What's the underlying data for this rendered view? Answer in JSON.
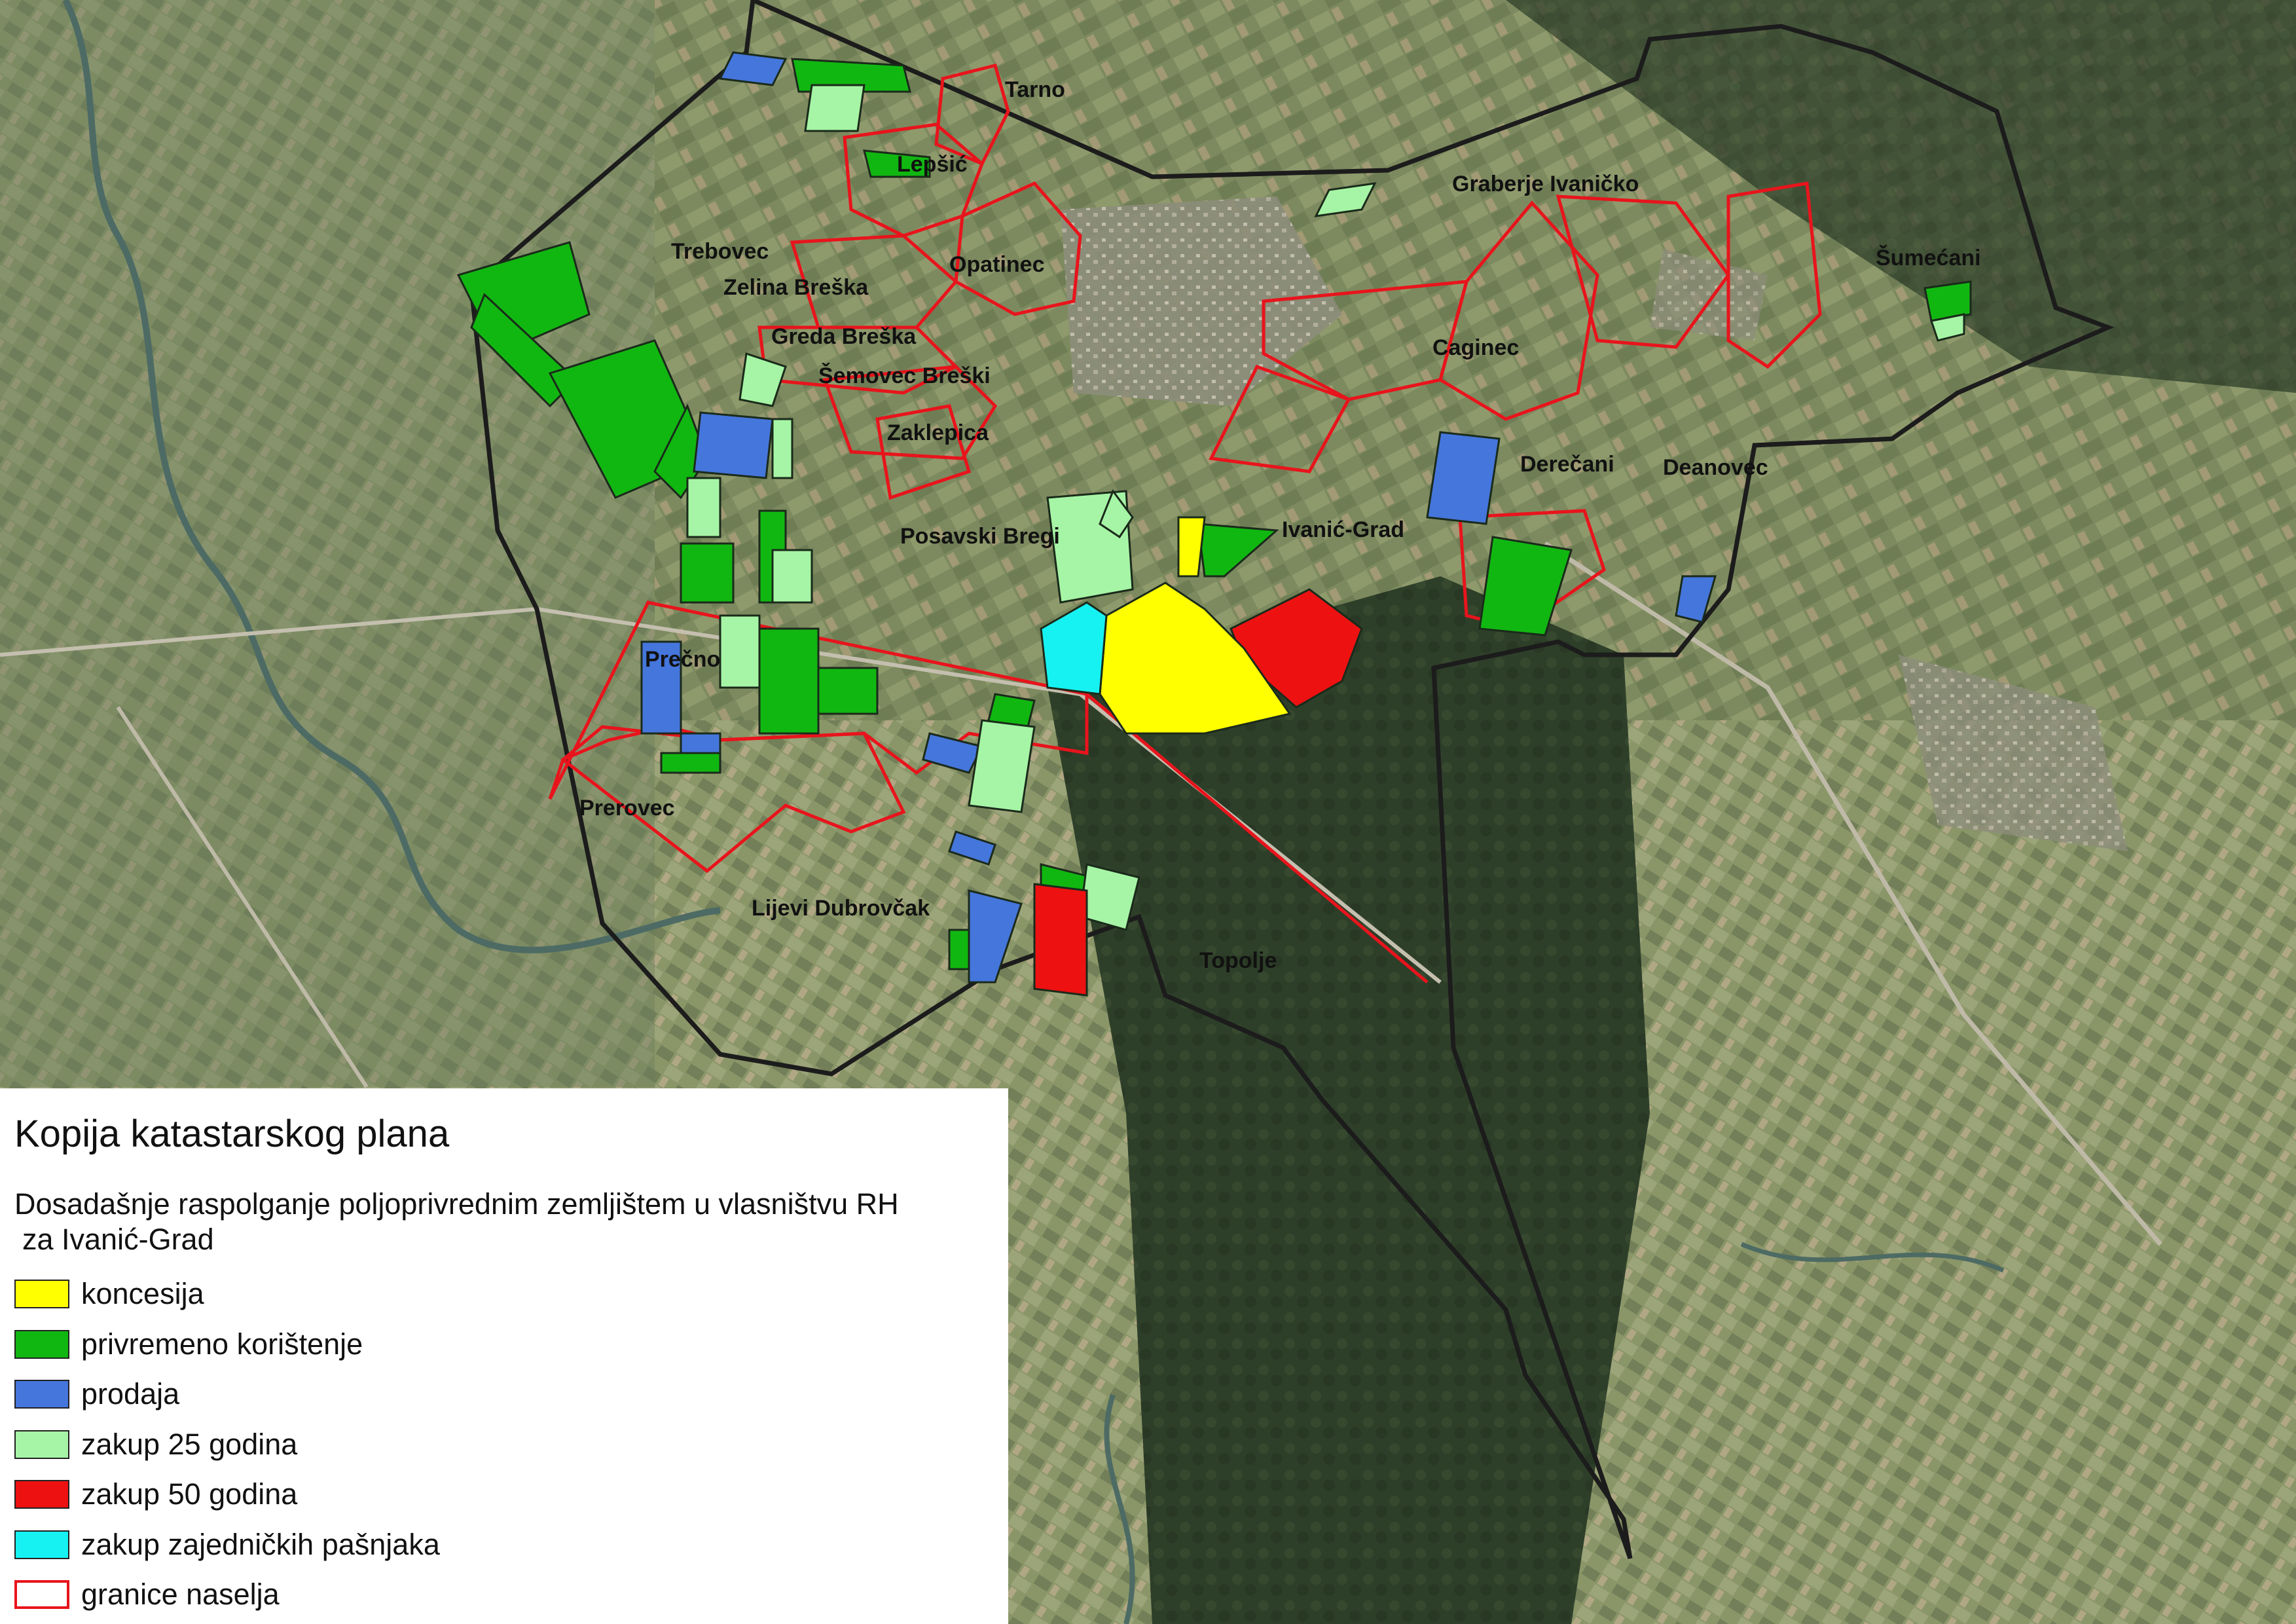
{
  "map": {
    "place_labels": [
      "Tarno",
      "Lepšić",
      "Trebovec",
      "Zelina Breška",
      "Opatinec",
      "Greda Breška",
      "Šemovec Breški",
      "Zaklepica",
      "Posavski Bregi",
      "Ivanić-Grad",
      "Prečno",
      "Prerovec",
      "Lijevi Dubrovčak",
      "Topolje",
      "Graberje Ivaničko",
      "Šumećani",
      "Caginec",
      "Derečani",
      "Deanovec"
    ],
    "colors": {
      "koncesija": "#ffff00",
      "privremeno_koristenje": "#11b711",
      "prodaja": "#4576dc",
      "zakup_25": "#a6f5a6",
      "zakup_50": "#ee1111",
      "zakup_pasnjaka": "#16f2f2",
      "granice_naselja": "#e8141c",
      "municipality_border": "#1c1c1c"
    }
  },
  "legend": {
    "title": "Kopija katastarskog plana",
    "subtitle_line1": "Dosadašnje raspolganje poljoprivrednim zemljištem u vlasništvu RH",
    "subtitle_line2": "za Ivanić-Grad",
    "items": [
      {
        "label": "koncesija",
        "color": "#ffff00"
      },
      {
        "label": "privremeno korištenje",
        "color": "#11b711"
      },
      {
        "label": "prodaja",
        "color": "#4576dc"
      },
      {
        "label": "zakup 25 godina",
        "color": "#a6f5a6"
      },
      {
        "label": "zakup 50 godina",
        "color": "#ee1111"
      },
      {
        "label": "zakup zajedničkih pašnjaka",
        "color": "#16f2f2"
      },
      {
        "label": "granice naselja",
        "color": "#e8141c",
        "outline": true
      }
    ]
  }
}
